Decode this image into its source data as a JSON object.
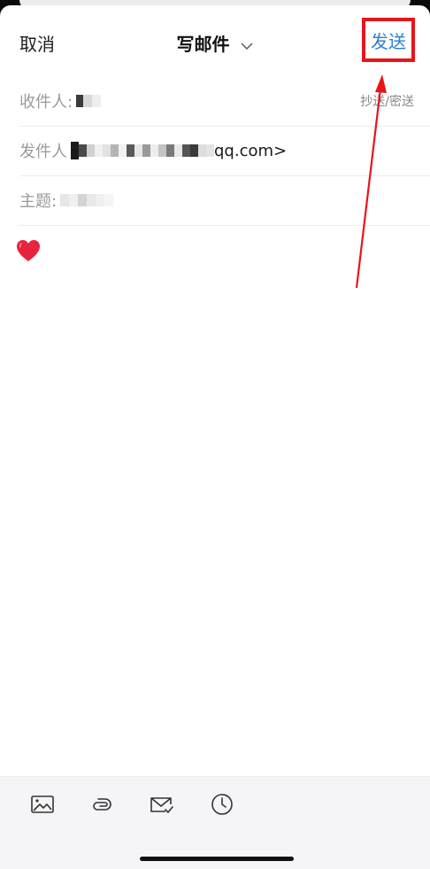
{
  "nav": {
    "cancel_label": "取消",
    "title": "写邮件",
    "send_label": "发送"
  },
  "fields": {
    "recipient_label": "收件人:",
    "cc_bcc_label": "抄送/密送",
    "sender_label": "发件人",
    "sender_visible_suffix": "qq.com>",
    "subject_label": "主题:"
  },
  "body": {
    "emoji": "heart-emoji"
  },
  "toolbar": {
    "items": [
      "image-icon",
      "attachment-icon",
      "mail-check-icon",
      "clock-icon"
    ]
  },
  "colors": {
    "accent": "#2d7fd4",
    "highlight": "#e8141a",
    "label": "#9a9a9a"
  }
}
